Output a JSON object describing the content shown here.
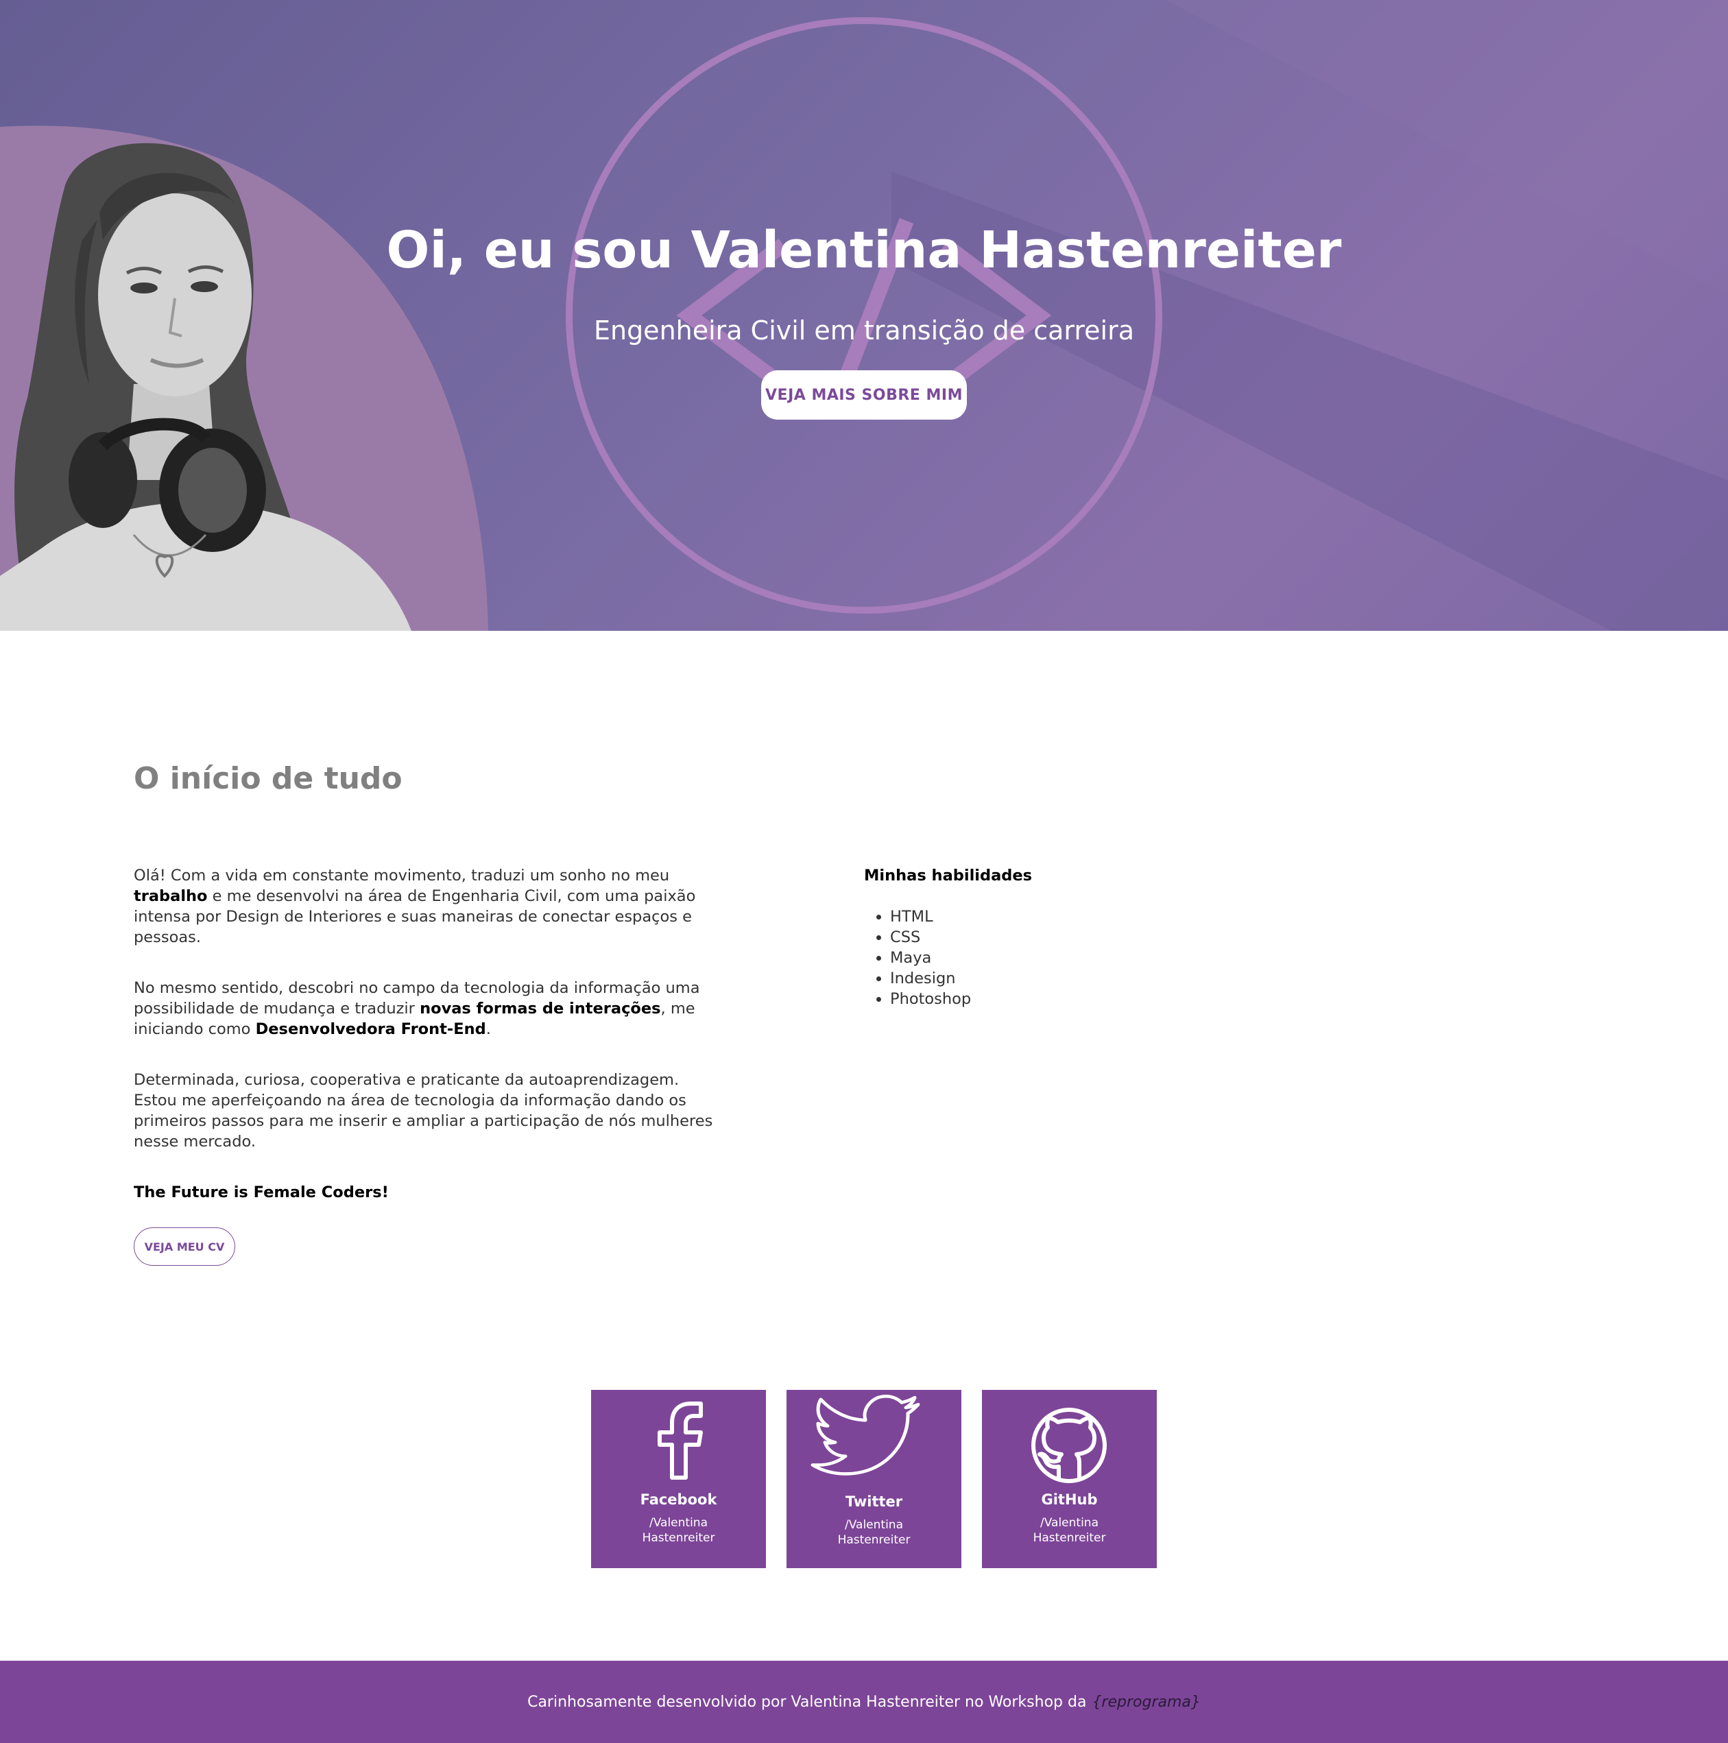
{
  "hero": {
    "title": "Oi, eu sou Valentina Hastenreiter",
    "subtitle": "Engenheira Civil em transição de carreira",
    "button_label": "VEJA MAIS SOBRE MIM",
    "logo_glyph": "</>"
  },
  "about": {
    "title": "O início de tudo",
    "p1_a": "Olá! Com a vida em constante movimento, traduzi um sonho no meu ",
    "p1_b": "trabalho",
    "p1_c": " e me desenvolvi na área de Engenharia Civil, com uma paixão intensa por Design de Interiores e suas maneiras de conectar espaços e pessoas.",
    "p2_a": "No mesmo sentido, descobri no campo da tecnologia da informação uma possibilidade de mudança e traduzir ",
    "p2_b": "novas formas de interações",
    "p2_c": ", me iniciando como ",
    "p2_d": "Desenvolvedora Front-End",
    "p2_e": ".",
    "p3": "Determinada, curiosa, cooperativa e praticante da autoaprendizagem. Estou me aperfeiçoando na área de tecnologia da informação dando os primeiros passos para me inserir e ampliar a participação de nós mulheres nesse mercado.",
    "future": "The Future is Female Coders!",
    "cv_button": "VEJA MEU CV"
  },
  "skills": {
    "title": "Minhas habilidades",
    "items": [
      "HTML",
      "CSS",
      "Maya",
      "Indesign",
      "Photoshop"
    ]
  },
  "social": [
    {
      "name": "Facebook",
      "handle_1": "/Valentina",
      "handle_2": "Hastenreiter",
      "icon": "facebook-icon"
    },
    {
      "name": "Twitter",
      "handle_1": "/Valentina",
      "handle_2": "Hastenreiter",
      "icon": "twitter-icon"
    },
    {
      "name": "GitHub",
      "handle_1": "/Valentina",
      "handle_2": "Hastenreiter",
      "icon": "github-icon"
    }
  ],
  "footer": {
    "text": "Carinhosamente desenvolvido por Valentina Hastenreiter no Workshop da",
    "brand": "{reprograma}"
  },
  "colors": {
    "hero_purple": "#786ba3",
    "accent_purple": "#7d4598",
    "logo_ring": "#a77dbb",
    "left_blob": "#9a7ba8"
  }
}
